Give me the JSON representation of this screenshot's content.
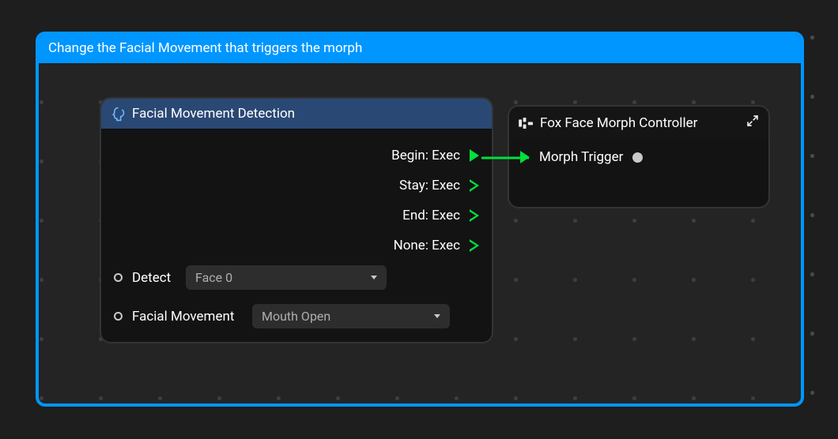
{
  "panel": {
    "title": "Change the Facial Movement that triggers the morph"
  },
  "nodeA": {
    "title": "Facial Movement Detection",
    "execs": {
      "begin": "Begin: Exec",
      "stay": "Stay: Exec",
      "end": "End: Exec",
      "none": "None: Exec"
    },
    "params": {
      "detect": {
        "label": "Detect",
        "value": "Face 0"
      },
      "facial": {
        "label": "Facial Movement",
        "value": "Mouth Open"
      }
    }
  },
  "nodeB": {
    "title": "Fox Face Morph Controller",
    "input": {
      "label": "Morph Trigger"
    }
  }
}
